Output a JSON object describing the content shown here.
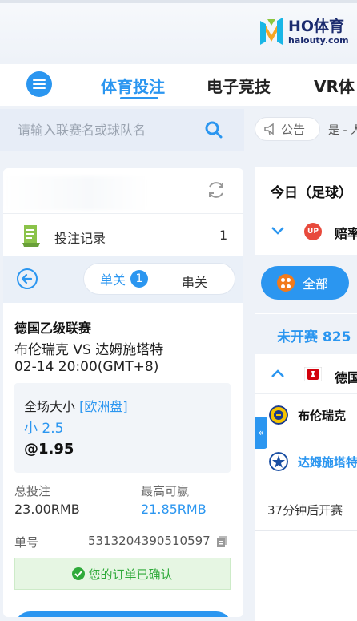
{
  "header": {
    "logo_name": "HO体育",
    "logo_url": "haiouty.com"
  },
  "nav": {
    "tabs": [
      {
        "label": "体育投注",
        "active": true
      },
      {
        "label": "电子竞技",
        "active": false
      },
      {
        "label": "VR体",
        "active": false
      }
    ]
  },
  "search": {
    "placeholder": "请输入联赛名或球队名"
  },
  "announcement": {
    "label": "公告",
    "marquee": "是 - 人"
  },
  "bet_panel": {
    "record_label": "投注记录",
    "record_count": "1",
    "mode_single": "单关",
    "mode_single_count": "1",
    "mode_parlay": "串关",
    "ticket": {
      "league": "德国乙级联赛",
      "teams": "布伦瑞克 VS 达姆施塔特",
      "kickoff": "02-14 20:00(GMT+8)",
      "market": "全场大小",
      "market_tag": "[欧洲盘]",
      "pick": "小 2.5",
      "odds": "@1.95",
      "stake_label": "总投注",
      "stake_value": "23.00RMB",
      "win_label": "最高可赢",
      "win_value": "21.85RMB",
      "order_label": "单号",
      "order_no": "5313204390510597",
      "confirm_text": "您的订单已确认"
    }
  },
  "right_panel": {
    "today": "今日（足球）",
    "odds_label": "赔率",
    "up_badge": "UP",
    "all_label": "全部",
    "upcoming": "未开赛 825",
    "league_name": "德国",
    "home_team": "布伦瑞克",
    "away_team": "达姆施塔特",
    "start_text": "37分钟后开赛",
    "collapse": "«"
  },
  "colors": {
    "accent": "#2b96f0",
    "success": "#2faa3a",
    "success_bg": "#e6f6e3",
    "logo_navy": "#1b2b6e"
  }
}
